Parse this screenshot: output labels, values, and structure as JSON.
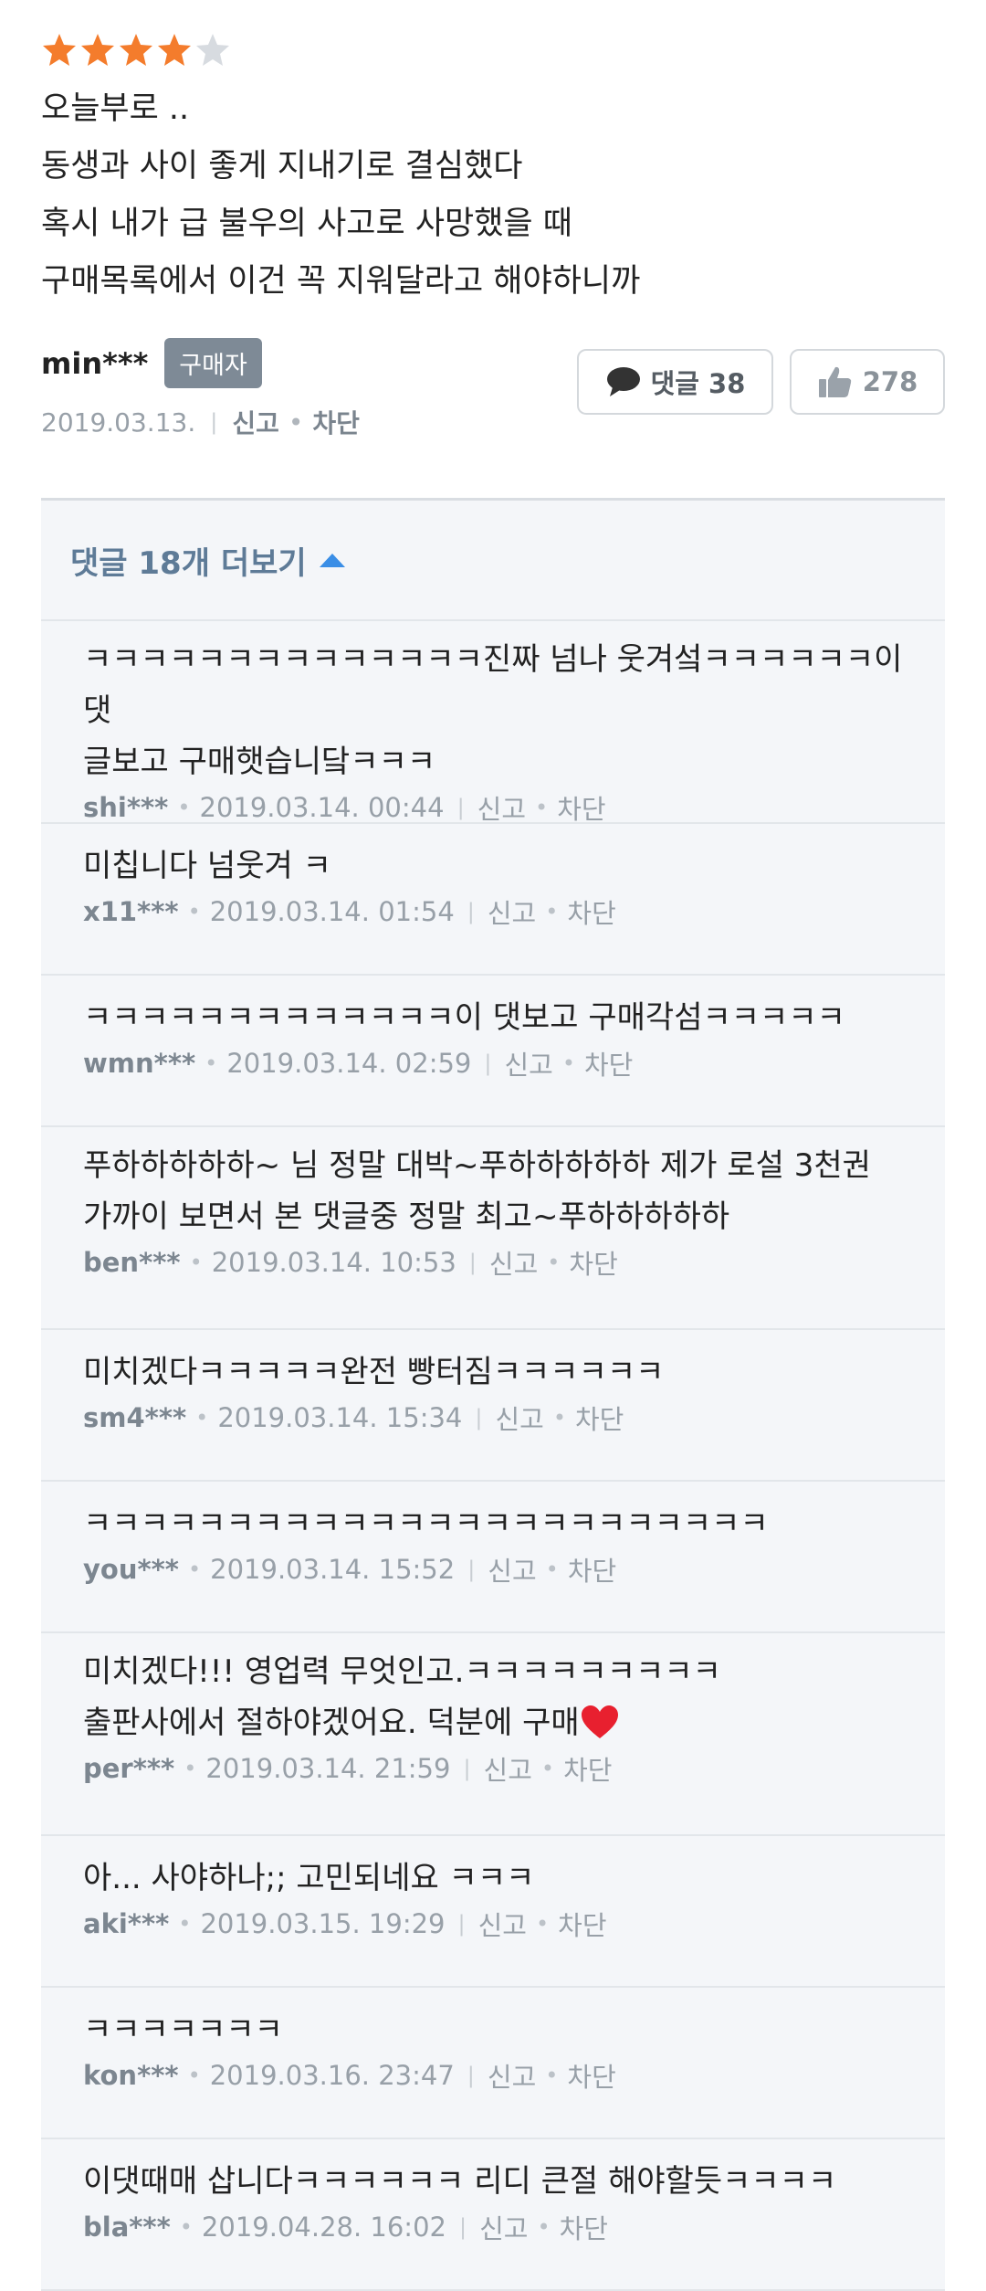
{
  "review": {
    "rating": 4,
    "max_rating": 5,
    "lines": [
      "오늘부로 ..",
      "동생과 사이 좋게 지내기로 결심했다",
      "혹시 내가 급 불우의 사고로 사망했을 때",
      "구매목록에서 이건 꼭 지워달라고 해야하니까"
    ],
    "author": "min***",
    "badge": "구매자",
    "date": "2019.03.13.",
    "report": "신고",
    "block": "차단",
    "comment_button": "댓글 38",
    "like_count": "278"
  },
  "comments_section": {
    "header": "댓글 18개 더보기",
    "items": [
      {
        "lines": [
          "ㅋㅋㅋㅋㅋㅋㅋㅋㅋㅋㅋㅋㅋㅋ진짜 넘나 웃겨섴ㅋㅋㅋㅋㅋㅋ이 댓",
          "글보고 구매햇습니닼ㅋㅋㅋ"
        ],
        "author": "shi***",
        "date": "2019.03.14. 00:44",
        "report": "신고",
        "block": "차단"
      },
      {
        "lines": [
          "미칩니다 넘웃겨 ㅋ"
        ],
        "author": "x11***",
        "date": "2019.03.14. 01:54",
        "report": "신고",
        "block": "차단"
      },
      {
        "lines": [
          "ㅋㅋㅋㅋㅋㅋㅋㅋㅋㅋㅋㅋㅋ이 댓보고 구매각섬ㅋㅋㅋㅋㅋ"
        ],
        "author": "wmn***",
        "date": "2019.03.14. 02:59",
        "report": "신고",
        "block": "차단"
      },
      {
        "lines": [
          "푸하하하하하~ 님 정말 대박~푸하하하하하 제가 로설 3천권",
          "가까이 보면서 본 댓글중 정말 최고~푸하하하하하"
        ],
        "author": "ben***",
        "date": "2019.03.14. 10:53",
        "report": "신고",
        "block": "차단"
      },
      {
        "lines": [
          "미치겠다ㅋㅋㅋㅋㅋ완전 빵터짐ㅋㅋㅋㅋㅋㅋ"
        ],
        "author": "sm4***",
        "date": "2019.03.14. 15:34",
        "report": "신고",
        "block": "차단"
      },
      {
        "lines": [
          "ㅋㅋㅋㅋㅋㅋㅋㅋㅋㅋㅋㅋㅋㅋㅋㅋㅋㅋㅋㅋㅋㅋㅋㅋ"
        ],
        "author": "you***",
        "date": "2019.03.14. 15:52",
        "report": "신고",
        "block": "차단"
      },
      {
        "lines": [
          "미치겠다!!! 영업력 무엇인고.ㅋㅋㅋㅋㅋㅋㅋㅋㅋ",
          "출판사에서 절하야겠어요. 덕분에 구매"
        ],
        "has_heart": true,
        "author": "per***",
        "date": "2019.03.14. 21:59",
        "report": "신고",
        "block": "차단"
      },
      {
        "lines": [
          "아... 사야하나;; 고민되네요 ㅋㅋㅋ"
        ],
        "author": "aki***",
        "date": "2019.03.15. 19:29",
        "report": "신고",
        "block": "차단"
      },
      {
        "lines": [
          "ㅋㅋㅋㅋㅋㅋㅋ"
        ],
        "author": "kon***",
        "date": "2019.03.16. 23:47",
        "report": "신고",
        "block": "차단"
      },
      {
        "lines": [
          "이댓때매 삽니다ㅋㅋㅋㅋㅋㅋ 리디 큰절 해야할듯ㅋㅋㅋㅋ"
        ],
        "author": "bla***",
        "date": "2019.04.28. 16:02",
        "report": "신고",
        "block": "차단"
      }
    ]
  },
  "colors": {
    "star_filled": "#f47c2c",
    "star_empty": "#d7dbe0",
    "link_blue": "#5e7b97",
    "heart": "#e8202f"
  }
}
